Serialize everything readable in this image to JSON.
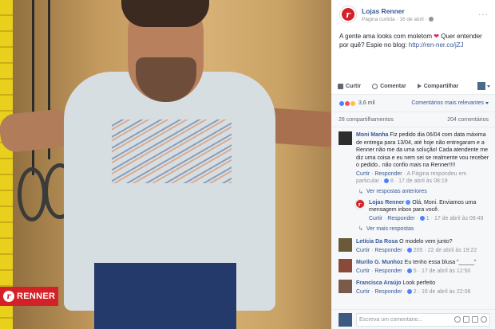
{
  "photo": {
    "brand_logo_text": "RENNER",
    "brand_logo_letter": "r"
  },
  "post": {
    "page_name": "Lojas Renner",
    "page_letter": "r",
    "meta": "Página curtida · 16 de abril ·",
    "caption_text": "A gente ama looks com moletom",
    "caption_text_2": "Quer entender por quê? Espie no blog:",
    "caption_link": "http://ren-ner.co/jZJ"
  },
  "actions": {
    "like": "Curtir",
    "comment": "Comentar",
    "share": "Compartilhar"
  },
  "reactions": {
    "count": "3,6 mil",
    "sort_label": "Comentários mais relevantes"
  },
  "counts": {
    "shares": "28 compartilhamentos",
    "comments": "204 comentários"
  },
  "comments": [
    {
      "name": "Moni Manha",
      "text": "Fiz pedido dia 06/04 com data máxima de entrega para 13/04, até hoje não entregaram e a Renner não me da uma solução! Cada atendente me diz uma coisa e eu nem sei se realmente vou receber o pedido.. não confio mais na Renner!!!!",
      "like": "Curtir",
      "reply": "Responder",
      "extra": "A Página respondeu em particular",
      "likes": "8",
      "date": "17 de abril às 08:19",
      "previous_replies": "Ver respostas anteriores",
      "reply_item": {
        "name": "Lojas Renner",
        "text": "Olá, Moni. Enviamos uma mensagem inbox para você.",
        "like": "Curtir",
        "reply": "Responder",
        "likes": "1",
        "date": "17 de abril às 09:49"
      },
      "more_replies": "Ver mais respostas"
    },
    {
      "name": "Letícia Da Rosa",
      "text": "O modelo vem junto?",
      "like": "Curtir",
      "reply": "Responder",
      "likes": "205",
      "date": "22 de abril às 19:22"
    },
    {
      "name": "Murilo G. Munhoz",
      "text": "Eu tenho essa blusa \"_____\"",
      "like": "Curtir",
      "reply": "Responder",
      "likes": "5",
      "date": "17 de abril às 12:50"
    },
    {
      "name": "Francisca Araújo",
      "text": "Look perfeito",
      "like": "Curtir",
      "reply": "Responder",
      "likes": "2",
      "date": "16 de abril às 22:08"
    }
  ],
  "compose": {
    "placeholder": "Escreva um comentário..."
  }
}
